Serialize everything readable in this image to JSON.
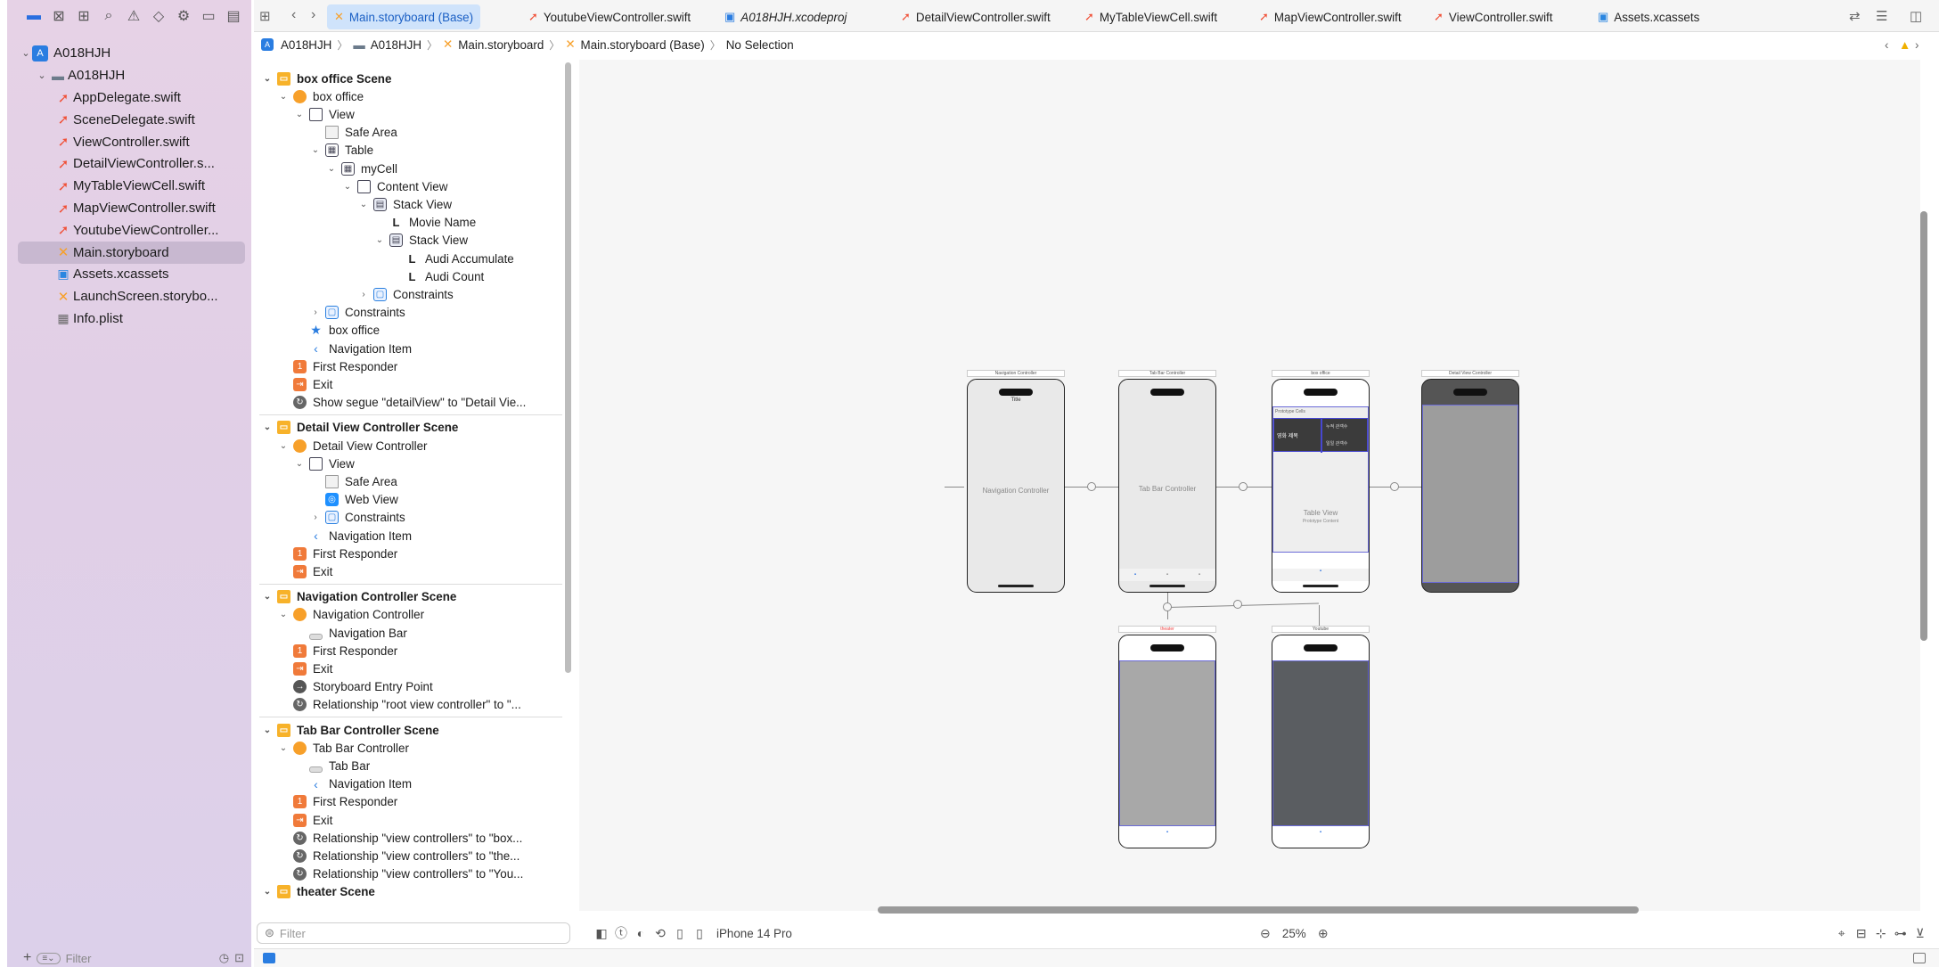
{
  "tabs": [
    {
      "label": "Main.storyboard (Base)",
      "icon": "storyboard-icon",
      "active": true
    },
    {
      "label": "YoutubeViewController.swift",
      "icon": "swift-icon",
      "active": false
    },
    {
      "label": "A018HJH.xcodeproj",
      "icon": "project-icon",
      "active": false
    },
    {
      "label": "DetailViewController.swift",
      "icon": "swift-icon",
      "active": false
    },
    {
      "label": "MyTableViewCell.swift",
      "icon": "swift-icon",
      "active": false
    },
    {
      "label": "MapViewController.swift",
      "icon": "swift-icon",
      "active": false
    },
    {
      "label": "ViewController.swift",
      "icon": "swift-icon",
      "active": false
    },
    {
      "label": "Assets.xcassets",
      "icon": "assets-icon",
      "active": false
    }
  ],
  "jump_bar": {
    "project": "A018HJH",
    "folder": "A018HJH",
    "file": "Main.storyboard",
    "localization": "Main.storyboard (Base)",
    "selection": "No Selection"
  },
  "navigator": {
    "project": "A018HJH",
    "group": "A018HJH",
    "files": [
      {
        "name": "AppDelegate.swift",
        "type": "swift"
      },
      {
        "name": "SceneDelegate.swift",
        "type": "swift"
      },
      {
        "name": "ViewController.swift",
        "type": "swift"
      },
      {
        "name": "DetailViewController.s...",
        "type": "swift"
      },
      {
        "name": "MyTableViewCell.swift",
        "type": "swift"
      },
      {
        "name": "MapViewController.swift",
        "type": "swift"
      },
      {
        "name": "YoutubeViewController...",
        "type": "swift"
      },
      {
        "name": "Main.storyboard",
        "type": "storyboard",
        "selected": true
      },
      {
        "name": "Assets.xcassets",
        "type": "assets"
      },
      {
        "name": "LaunchScreen.storybo...",
        "type": "storyboard"
      },
      {
        "name": "Info.plist",
        "type": "plist"
      }
    ],
    "filter_placeholder": "Filter"
  },
  "outline": {
    "rows": [
      {
        "label": "box office Scene",
        "indent": 0,
        "disc": "open",
        "icon": "scn",
        "scene": true
      },
      {
        "label": "box office",
        "indent": 1,
        "disc": "open",
        "icon": "vc"
      },
      {
        "label": "View",
        "indent": 2,
        "disc": "open",
        "icon": "view"
      },
      {
        "label": "Safe Area",
        "indent": 3,
        "icon": "safe"
      },
      {
        "label": "Table",
        "indent": 3,
        "disc": "open",
        "icon": "tbl"
      },
      {
        "label": "myCell",
        "indent": 4,
        "disc": "open",
        "icon": "tbl"
      },
      {
        "label": "Content View",
        "indent": 5,
        "disc": "open",
        "icon": "view"
      },
      {
        "label": "Stack View",
        "indent": 6,
        "disc": "open",
        "icon": "stk"
      },
      {
        "label": "Movie Name",
        "indent": 7,
        "icon": "label"
      },
      {
        "label": "Stack View",
        "indent": 7,
        "disc": "open",
        "icon": "stk"
      },
      {
        "label": "Audi Accumulate",
        "indent": 8,
        "icon": "label"
      },
      {
        "label": "Audi Count",
        "indent": 8,
        "icon": "label"
      },
      {
        "label": "Constraints",
        "indent": 6,
        "disc": "closed",
        "icon": "cons"
      },
      {
        "label": "Constraints",
        "indent": 3,
        "disc": "closed",
        "icon": "cons"
      },
      {
        "label": "box office",
        "indent": 2,
        "icon": "star"
      },
      {
        "label": "Navigation Item",
        "indent": 2,
        "icon": "back"
      },
      {
        "label": "First Responder",
        "indent": 1,
        "icon": "fr"
      },
      {
        "label": "Exit",
        "indent": 1,
        "icon": "exit"
      },
      {
        "label": "Show segue \"detailView\" to \"Detail Vie...",
        "indent": 1,
        "icon": "seg"
      },
      {
        "sep": true
      },
      {
        "label": "Detail View Controller Scene",
        "indent": 0,
        "disc": "open",
        "icon": "scn",
        "scene": true
      },
      {
        "label": "Detail View Controller",
        "indent": 1,
        "disc": "open",
        "icon": "vc"
      },
      {
        "label": "View",
        "indent": 2,
        "disc": "open",
        "icon": "view"
      },
      {
        "label": "Safe Area",
        "indent": 3,
        "icon": "safe"
      },
      {
        "label": "Web View",
        "indent": 3,
        "icon": "web"
      },
      {
        "label": "Constraints",
        "indent": 3,
        "disc": "closed",
        "icon": "cons"
      },
      {
        "label": "Navigation Item",
        "indent": 2,
        "icon": "back"
      },
      {
        "label": "First Responder",
        "indent": 1,
        "icon": "fr"
      },
      {
        "label": "Exit",
        "indent": 1,
        "icon": "exit"
      },
      {
        "sep": true
      },
      {
        "label": "Navigation Controller Scene",
        "indent": 0,
        "disc": "open",
        "icon": "scn",
        "scene": true
      },
      {
        "label": "Navigation Controller",
        "indent": 1,
        "disc": "open",
        "icon": "vc"
      },
      {
        "label": "Navigation Bar",
        "indent": 2,
        "icon": "bar"
      },
      {
        "label": "First Responder",
        "indent": 1,
        "icon": "fr"
      },
      {
        "label": "Exit",
        "indent": 1,
        "icon": "exit"
      },
      {
        "label": "Storyboard Entry Point",
        "indent": 1,
        "icon": "entry"
      },
      {
        "label": "Relationship \"root view controller\" to \"...",
        "indent": 1,
        "icon": "seg"
      },
      {
        "sep": true
      },
      {
        "label": "Tab Bar Controller Scene",
        "indent": 0,
        "disc": "open",
        "icon": "scn",
        "scene": true
      },
      {
        "label": "Tab Bar Controller",
        "indent": 1,
        "disc": "open",
        "icon": "vc"
      },
      {
        "label": "Tab Bar",
        "indent": 2,
        "icon": "bar"
      },
      {
        "label": "Navigation Item",
        "indent": 2,
        "icon": "back"
      },
      {
        "label": "First Responder",
        "indent": 1,
        "icon": "fr"
      },
      {
        "label": "Exit",
        "indent": 1,
        "icon": "exit"
      },
      {
        "label": "Relationship \"view controllers\" to \"box...",
        "indent": 1,
        "icon": "seg"
      },
      {
        "label": "Relationship \"view controllers\" to \"the...",
        "indent": 1,
        "icon": "seg"
      },
      {
        "label": "Relationship \"view controllers\" to \"You...",
        "indent": 1,
        "icon": "seg"
      },
      {
        "label": "theater Scene",
        "indent": 0,
        "disc": "open",
        "icon": "scn",
        "scene": true
      }
    ],
    "filter_placeholder": "Filter"
  },
  "canvas": {
    "frames": {
      "nav": {
        "title": "Navigation Controller",
        "center": "Navigation Controller",
        "top_label": "Title"
      },
      "tab": {
        "title": "Tab Bar Controller",
        "center": "Tab Bar Controller"
      },
      "box": {
        "title": "box office",
        "center": "Table View",
        "sub": "Prototype Content",
        "section": "Prototype Cells",
        "cell_a": "영화 제목",
        "cell_b": "누적 관객수",
        "cell_c": "일일 관객수"
      },
      "web": {
        "title": "Detail View Controller"
      },
      "theater": {
        "title": "theater"
      },
      "youtube": {
        "title": "Youtube"
      }
    }
  },
  "bottom_bar": {
    "device": "iPhone 14 Pro",
    "zoom": "25%"
  },
  "colors": {
    "accent": "#2a7de1",
    "sidebar_bg": "#e3d1e7",
    "swift": "#f05138",
    "storyboard": "#f7a02a"
  }
}
